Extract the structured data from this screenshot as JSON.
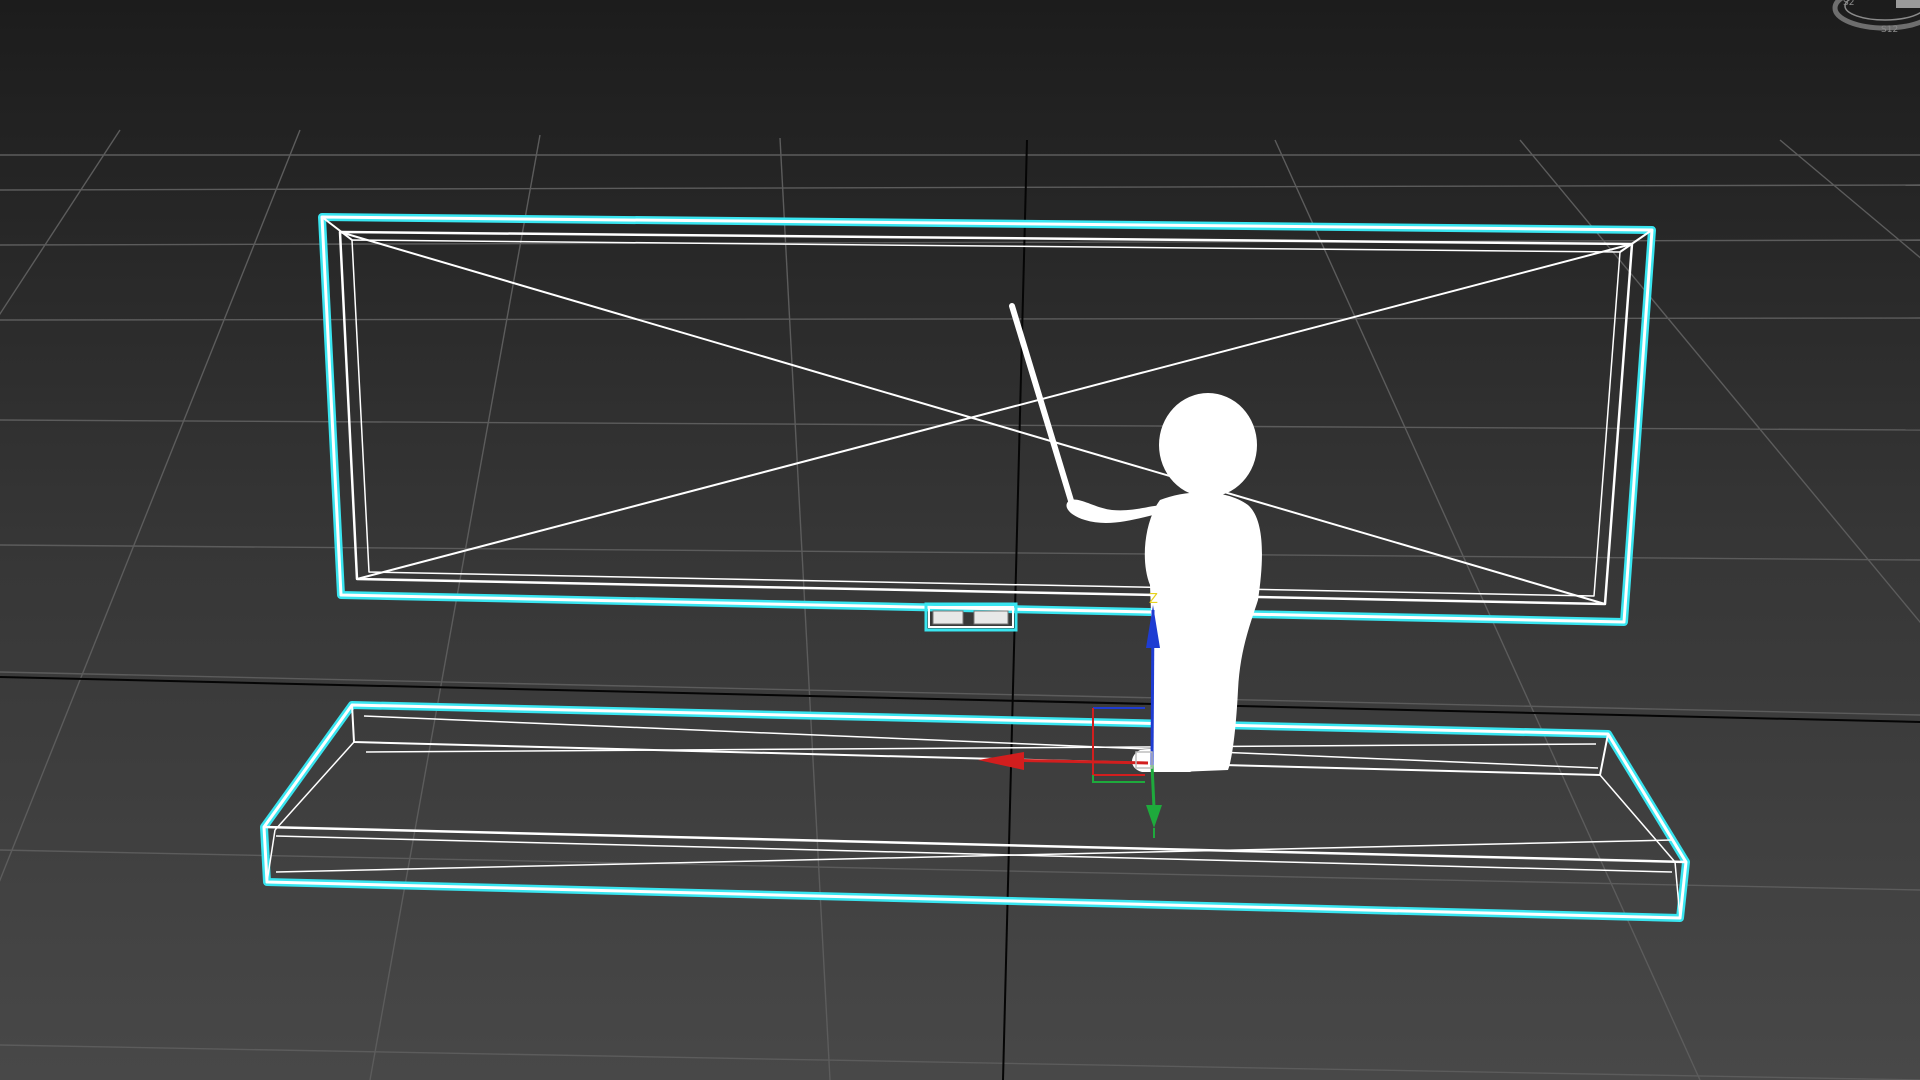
{
  "viewport": {
    "type": "3d-perspective-viewport",
    "background_top": "#1c1c1c",
    "background_bottom": "#484848",
    "grid_color": "#5a5a5a",
    "axis_line_color": "#000000",
    "wire_color": "#ffffff",
    "selection_color": "#39e5f0"
  },
  "viewcube": {
    "icon": "viewcube-ring-icon",
    "label_left": "S2",
    "label_bottom": "S12"
  },
  "objects": [
    {
      "name": "blackboard",
      "state": "selected",
      "display": "wireframe"
    },
    {
      "name": "platform",
      "state": "selected",
      "display": "wireframe"
    },
    {
      "name": "teacher-figure",
      "state": "unselected",
      "display": "shaded-white"
    },
    {
      "name": "pointer-stick",
      "state": "unselected",
      "display": "shaded-white"
    },
    {
      "name": "eraser",
      "state": "selected",
      "display": "wireframe"
    }
  ],
  "gizmo": {
    "type": "transform-gizmo",
    "axes": [
      {
        "axis": "x",
        "color": "#d21e1e"
      },
      {
        "axis": "y",
        "color": "#1eaa3c"
      },
      {
        "axis": "z",
        "color": "#1e3cd2",
        "label_color": "#e6d21e",
        "label": "Z"
      }
    ]
  }
}
